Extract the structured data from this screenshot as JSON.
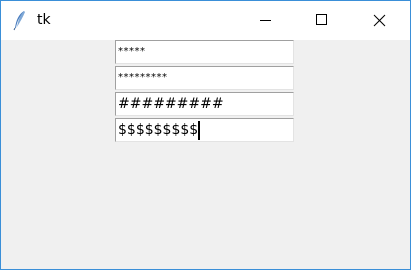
{
  "window": {
    "title": "tk",
    "icon": "feather-icon"
  },
  "controls": {
    "minimize_icon": "minimize-icon",
    "maximize_icon": "maximize-icon",
    "close_icon": "close-icon"
  },
  "entries": [
    {
      "value": "*****"
    },
    {
      "value": "*********"
    },
    {
      "value": "#########"
    },
    {
      "value": "$$$$$$$$$"
    }
  ],
  "colors": {
    "window_border": "#3a8fd8",
    "titlebar_bg": "#ffffff",
    "client_bg": "#f0f0f0"
  }
}
